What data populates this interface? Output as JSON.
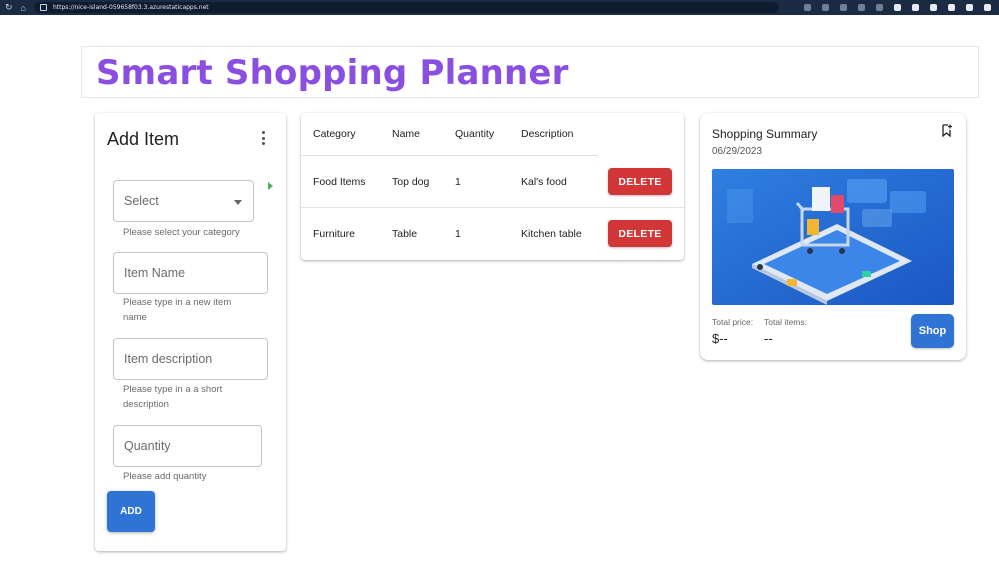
{
  "browser": {
    "url": "https://nice-island-059658f03.3.azurestaticapps.net"
  },
  "app": {
    "title": "Smart Shopping Planner"
  },
  "add_item": {
    "header": "Add Item",
    "category_select": {
      "value": "Select",
      "helper": "Please select your category"
    },
    "name_field": {
      "placeholder": "Item Name",
      "helper": "Please type in a new item name"
    },
    "description_field": {
      "placeholder": "Item description",
      "helper": "Please type in a a short description"
    },
    "quantity_field": {
      "placeholder": "Quantity",
      "helper": "Please add quantity"
    },
    "add_label": "ADD"
  },
  "table": {
    "columns": [
      "Category",
      "Name",
      "Quantity",
      "Description"
    ],
    "rows": [
      {
        "category": "Food Items",
        "name": "Top dog",
        "quantity": "1",
        "description": "Kal's food",
        "action": "DELETE"
      },
      {
        "category": "Furniture",
        "name": "Table",
        "quantity": "1",
        "description": "Kitchen table",
        "action": "DELETE"
      }
    ]
  },
  "summary": {
    "title": "Shopping Summary",
    "date": "06/29/2023",
    "total_price_label": "Total price:",
    "total_price_value": "$--",
    "total_items_label": "Total items:",
    "total_items_value": "--",
    "shop_label": "Shop"
  },
  "colors": {
    "title": "#8a4fe0",
    "primary": "#2f74d4",
    "danger": "#d33636",
    "browser_bar": "#1b2b44"
  },
  "icons": [
    "refresh-icon",
    "home-icon",
    "lock-icon",
    "kebab-menu-icon",
    "dropdown-caret-icon",
    "bookmark-add-icon"
  ]
}
